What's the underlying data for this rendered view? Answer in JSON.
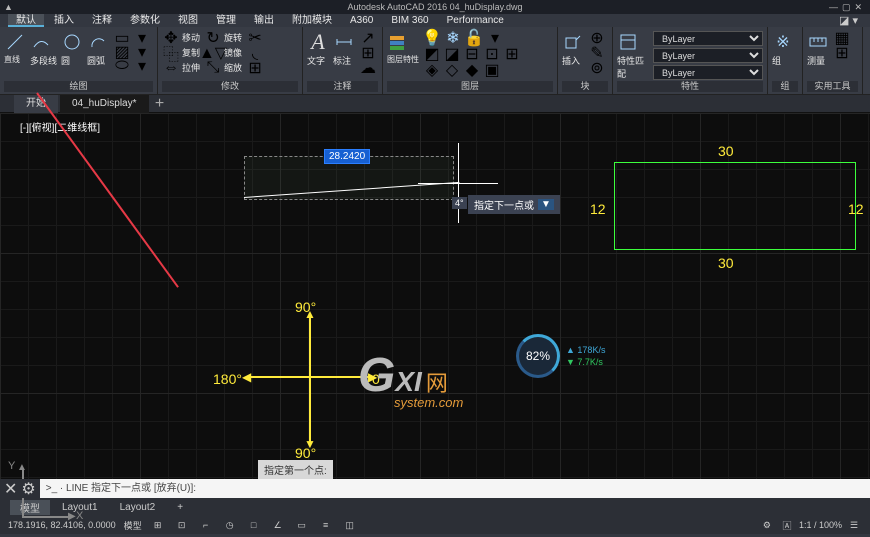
{
  "app_title": "Autodesk AutoCAD 2016    04_huDisplay.dwg",
  "menu_tabs": [
    "默认",
    "插入",
    "注释",
    "参数化",
    "视图",
    "管理",
    "输出",
    "附加模块",
    "A360",
    "BIM 360",
    "Performance"
  ],
  "active_tab": 0,
  "ribbon": {
    "draw": {
      "label": "绘图",
      "polyline": "多段线",
      "line": "直线",
      "circle": "圆",
      "arc": "圆弧"
    },
    "modify": {
      "label": "修改",
      "move": "移动",
      "copy": "复制",
      "stretch": "拉伸",
      "rotate": "旋转",
      "mirror": "镜像",
      "scale": "缩放"
    },
    "annotate": {
      "label": "注释",
      "text": "文字",
      "dim": "标注"
    },
    "layers": {
      "label": "图层",
      "layer_props": "图层特性"
    },
    "block": {
      "label": "块",
      "insert": "插入"
    },
    "props": {
      "label": "特性",
      "match": "特性匹配",
      "bylayer": "ByLayer"
    },
    "group": {
      "label": "组",
      "grp": "组"
    },
    "utility": {
      "label": "实用工具",
      "measure": "测量"
    }
  },
  "doc_tabs": [
    "开始",
    "04_huDisplay*"
  ],
  "active_doc": 1,
  "viewport_label": "[-][俯视][二维线框]",
  "drawing": {
    "dyn_dist": "28.2420",
    "dyn_angle": "4°",
    "tooltip": "指定下一点或",
    "rect_top": "30",
    "rect_bottom": "30",
    "rect_left": "12",
    "rect_right": "12",
    "angle_0": "0°",
    "angle_90t": "90°",
    "angle_90b": "90°",
    "angle_180": "180°"
  },
  "watermark": {
    "brand": "GXI",
    "suffix": "网",
    "sub": "system.com"
  },
  "gauge": {
    "pct": "82%",
    "up": "178K/s",
    "down": "7.7K/s"
  },
  "ucs": {
    "x": "X",
    "y": "Y"
  },
  "cmd_hint": "指定第一个点:",
  "cmdline": ">_ · LINE 指定下一点或  [放弃(U)]:",
  "layout_tabs": [
    "模型",
    "Layout1",
    "Layout2"
  ],
  "active_layout": 0,
  "status": {
    "coords": "178.1916, 82.4106, 0.0000",
    "space": "模型",
    "zoom": "1:1 / 100%"
  }
}
